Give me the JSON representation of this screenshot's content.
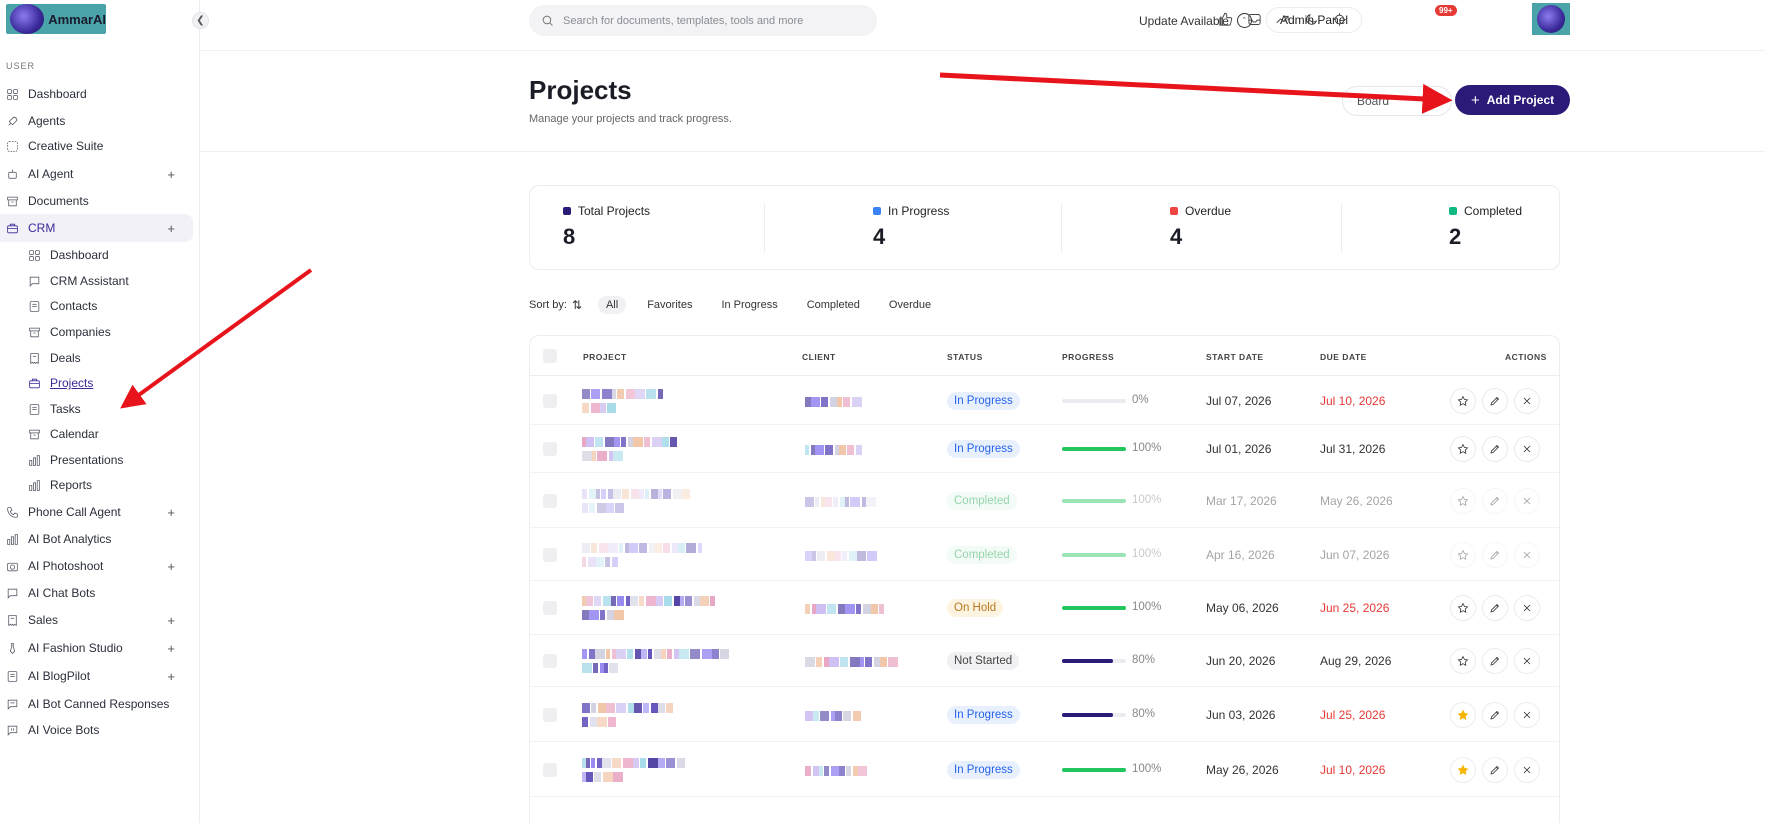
{
  "brand": {
    "name": "AmmarAI"
  },
  "sidebar": {
    "section_label": "USER",
    "items": [
      {
        "label": "Dashboard",
        "icon": "dashboard-icon"
      },
      {
        "label": "Agents",
        "icon": "rocket-icon"
      },
      {
        "label": "Creative Suite",
        "icon": "creative-icon"
      },
      {
        "label": "AI Agent",
        "icon": "robot-icon",
        "plus": "+"
      },
      {
        "label": "Documents",
        "icon": "archive-icon"
      },
      {
        "label": "CRM",
        "icon": "briefcase-icon",
        "plus": "+"
      },
      {
        "label": "Phone Call Agent",
        "icon": "phone-icon",
        "plus": "+"
      },
      {
        "label": "AI Bot Analytics",
        "icon": "bar-chart-icon"
      },
      {
        "label": "AI Photoshoot",
        "icon": "camera-icon",
        "plus": "+"
      },
      {
        "label": "AI Chat Bots",
        "icon": "chat-icon"
      },
      {
        "label": "Sales",
        "icon": "receipt-icon",
        "plus": "+"
      },
      {
        "label": "AI Fashion Studio",
        "icon": "tie-icon",
        "plus": "+"
      },
      {
        "label": "AI BlogPilot",
        "icon": "blog-icon",
        "plus": "+"
      },
      {
        "label": "AI Bot Canned Responses",
        "icon": "message-icon"
      },
      {
        "label": "AI Voice Bots",
        "icon": "voice-icon"
      }
    ],
    "crm_sub": [
      {
        "label": "Dashboard"
      },
      {
        "label": "CRM Assistant"
      },
      {
        "label": "Contacts"
      },
      {
        "label": "Companies"
      },
      {
        "label": "Deals"
      },
      {
        "label": "Projects"
      },
      {
        "label": "Tasks"
      },
      {
        "label": "Calendar"
      },
      {
        "label": "Presentations"
      },
      {
        "label": "Reports"
      }
    ]
  },
  "header": {
    "search_placeholder": "Search for documents, templates, tools and more",
    "update_label": "Update Available",
    "admin_label": "Admin Panel",
    "notification_badge": "99+"
  },
  "page": {
    "title": "Projects",
    "subtitle": "Manage your projects and track progress.",
    "board_label": "Board",
    "add_label": "Add Project"
  },
  "stats": [
    {
      "label": "Total Projects",
      "value": "8",
      "color": "#2b1a78"
    },
    {
      "label": "In Progress",
      "value": "4",
      "color": "#3b82f6"
    },
    {
      "label": "Overdue",
      "value": "4",
      "color": "#ef4444"
    },
    {
      "label": "Completed",
      "value": "2",
      "color": "#10b981"
    }
  ],
  "sort": {
    "label": "Sort by:",
    "filters": [
      "All",
      "Favorites",
      "In Progress",
      "Completed",
      "Overdue"
    ],
    "active": "All"
  },
  "table": {
    "columns": [
      "PROJECT",
      "CLIENT",
      "STATUS",
      "PROGRESS",
      "START DATE",
      "DUE DATE",
      "ACTIONS"
    ],
    "rows": [
      {
        "status": "In Progress",
        "progress": 0,
        "progress_label": "0%",
        "start": "Jul 07, 2026",
        "due": "Jul 10, 2026",
        "overdue": true,
        "favorite": false,
        "faded": false
      },
      {
        "status": "In Progress",
        "progress": 100,
        "progress_label": "100%",
        "start": "Jul 01, 2026",
        "due": "Jul 31, 2026",
        "overdue": false,
        "favorite": false,
        "faded": false
      },
      {
        "status": "Completed",
        "progress": 100,
        "progress_label": "100%",
        "start": "Mar 17, 2026",
        "due": "May 26, 2026",
        "overdue": false,
        "favorite": false,
        "faded": true
      },
      {
        "status": "Completed",
        "progress": 100,
        "progress_label": "100%",
        "start": "Apr 16, 2026",
        "due": "Jun 07, 2026",
        "overdue": false,
        "favorite": false,
        "faded": true
      },
      {
        "status": "On Hold",
        "progress": 100,
        "progress_label": "100%",
        "start": "May 06, 2026",
        "due": "Jun 25, 2026",
        "overdue": true,
        "favorite": false,
        "faded": false
      },
      {
        "status": "Not Started",
        "progress": 80,
        "progress_label": "80%",
        "start": "Jun 20, 2026",
        "due": "Aug 29, 2026",
        "overdue": false,
        "favorite": false,
        "faded": false
      },
      {
        "status": "In Progress",
        "progress": 80,
        "progress_label": "80%",
        "start": "Jun 03, 2026",
        "due": "Jul 25, 2026",
        "overdue": true,
        "favorite": true,
        "faded": false
      },
      {
        "status": "In Progress",
        "progress": 100,
        "progress_label": "100%",
        "start": "May 26, 2026",
        "due": "Jul 10, 2026",
        "overdue": true,
        "favorite": true,
        "faded": false
      }
    ]
  },
  "colors": {
    "accent": "#2b1a78",
    "blue": "#3b82f6",
    "red": "#e53935",
    "green": "#22c55e",
    "amber": "#d97706"
  }
}
